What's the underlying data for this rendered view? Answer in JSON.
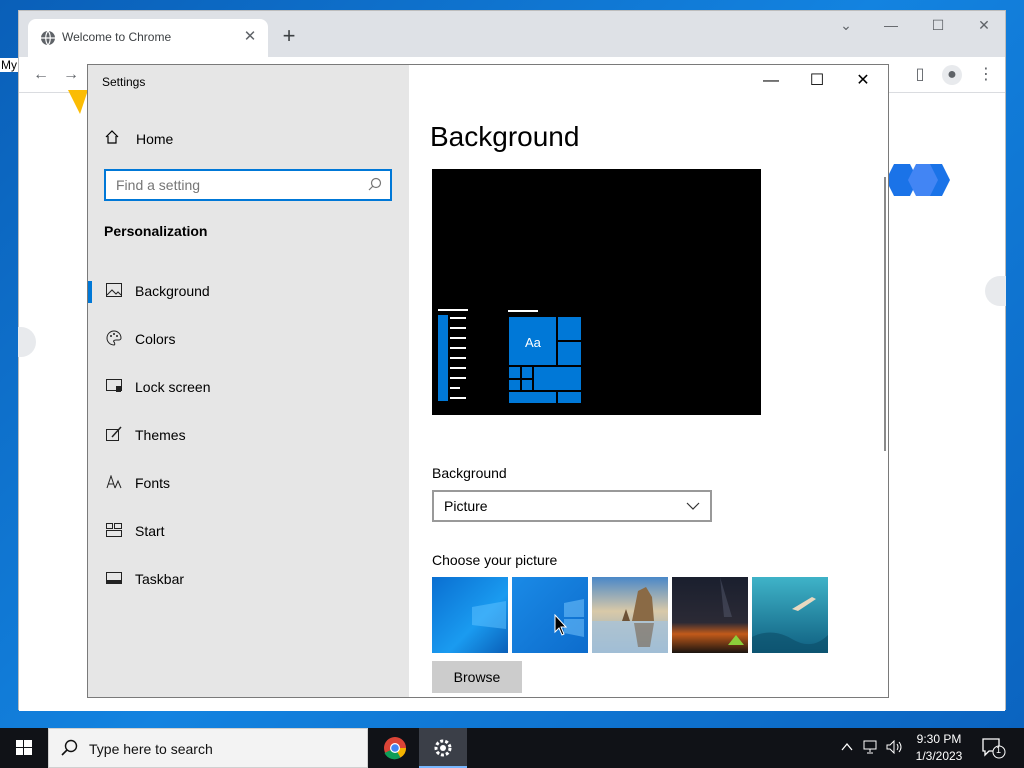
{
  "desktop": {
    "label": "My"
  },
  "chrome": {
    "tab_title": "Welcome to Chrome",
    "tab_close": "✕",
    "new_tab": "+",
    "controls": {
      "tabsearch": "⌄",
      "minimize": "—",
      "maximize": "☐",
      "close": "✕"
    },
    "toolbar": {
      "back": "←",
      "forward": "→",
      "sidepanel": "▯",
      "profile": "●",
      "menu": "⋮"
    }
  },
  "settings": {
    "app_title": "Settings",
    "controls": {
      "minimize": "—",
      "maximize": "☐",
      "close": "✕"
    },
    "home_label": "Home",
    "search_placeholder": "Find a setting",
    "section_label": "Personalization",
    "nav_items": [
      {
        "label": "Background",
        "icon": "picture-icon"
      },
      {
        "label": "Colors",
        "icon": "palette-icon"
      },
      {
        "label": "Lock screen",
        "icon": "lock-screen-icon"
      },
      {
        "label": "Themes",
        "icon": "themes-icon"
      },
      {
        "label": "Fonts",
        "icon": "fonts-icon"
      },
      {
        "label": "Start",
        "icon": "start-icon"
      },
      {
        "label": "Taskbar",
        "icon": "taskbar-icon"
      }
    ],
    "active_nav": "Background",
    "page_title": "Background",
    "preview_tile_text": "Aa",
    "background_label": "Background",
    "background_value": "Picture",
    "choose_picture_label": "Choose your picture",
    "browse_label": "Browse",
    "accent_color": "#0078d7"
  },
  "taskbar": {
    "search_placeholder": "Type here to search",
    "time": "9:30 PM",
    "date": "1/3/2023",
    "notification_count": "1"
  }
}
